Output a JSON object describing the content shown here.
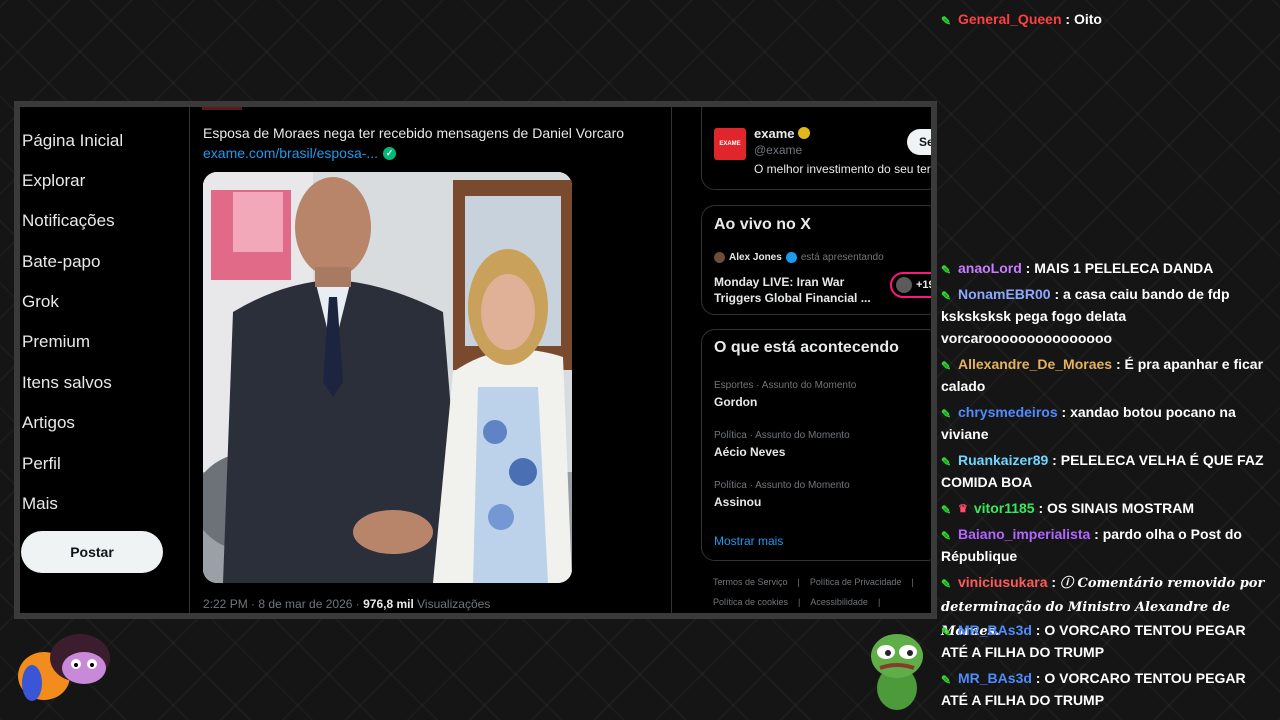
{
  "x_app": {
    "nav": {
      "items": [
        "Página Inicial",
        "Explorar",
        "Notificações",
        "Bate-papo",
        "Grok",
        "Premium",
        "Itens salvos",
        "Artigos",
        "Perfil",
        "Mais"
      ],
      "post_button": "Postar"
    },
    "tweet": {
      "text": "Esposa de Moraes nega ter recebido mensagens de Daniel Vorcaro",
      "link": "exame.com/brasil/esposa-...",
      "time": "2:22 PM · 8 de mar de 2026 · ",
      "views_count": "976,8 mil",
      "views_label": " Visualizações"
    },
    "who_to_follow": {
      "logo_text": "EXAME",
      "name": "exame",
      "handle": "@exame",
      "bio": "O melhor investimento do seu ter",
      "follow_button": "Se"
    },
    "live": {
      "title": "Ao vivo no X",
      "host": "Alex Jones",
      "host_suffix": "está apresentando",
      "show_line1": "Monday LIVE: Iran War",
      "show_line2": "Triggers Global Financial ...",
      "listeners": "+19"
    },
    "trends": {
      "title": "O que está acontecendo",
      "items": [
        {
          "category": "Esportes · Assunto do Momento",
          "name": "Gordon"
        },
        {
          "category": "Política · Assunto do Momento",
          "name": "Aécio Neves"
        },
        {
          "category": "Política · Assunto do Momento",
          "name": "Assinou"
        }
      ],
      "show_more": "Mostrar mais"
    },
    "footer": {
      "row1": [
        "Termos de Serviço",
        "|",
        "Política de Privacidade",
        "|"
      ],
      "row2": [
        "Política de cookies",
        "|",
        "Acessibilidade",
        "|"
      ]
    }
  },
  "chat": {
    "messages": [
      {
        "user": "General_Queen",
        "color": "#ff4040",
        "text": "Oito"
      },
      {
        "user": "anaoLord",
        "color": "#c77dff",
        "text": "MAIS 1 PELELECA DANDA"
      },
      {
        "user": "NonamEBR00",
        "color": "#8fa8ff",
        "text": "a casa caiu bando de fdp ksksksksk pega fogo delata vorcarooooooooooooooo"
      },
      {
        "user": "Allexandre_De_Moraes",
        "color": "#e6b35c",
        "text": "É pra apanhar e ficar calado"
      },
      {
        "user": "chrysmedeiros",
        "color": "#4f8cff",
        "text": "xandao botou pocano na viviane"
      },
      {
        "user": "Ruankaizer89",
        "color": "#6fd6ff",
        "text": "PELELECA VELHA É QUE FAZ COMIDA BOA"
      },
      {
        "user": "vitor1185",
        "color": "#39e85a",
        "text": "OS SINAIS MOSTRAM"
      },
      {
        "user": "Baiano_imperialista",
        "color": "#b266ff",
        "text": "pardo olha o Post do République"
      },
      {
        "user": "viniciusukara",
        "color": "#ff5a5a",
        "text": "ⓘ Comentário removido por determinação do Ministro Alexandre de Moraes."
      },
      {
        "user": "MR_BAs3d",
        "color": "#4f8cff",
        "text": "O VORCARO TENTOU PEGAR ATÉ A FILHA DO TRUMP"
      },
      {
        "user": "MR_BAs3d",
        "color": "#4f8cff",
        "text": "O VORCARO TENTOU PEGAR ATÉ A FILHA DO TRUMP"
      }
    ]
  },
  "colors": {
    "x_blue": "#1d9bf0",
    "live_pink": "#f91880",
    "badge_green": "#2fd82f",
    "exame_red": "#e0252b"
  },
  "icons": [
    "verified-check-icon",
    "gold-verified-icon",
    "blue-verified-icon",
    "mod-badge-icon",
    "subscriber-badge-icon"
  ]
}
